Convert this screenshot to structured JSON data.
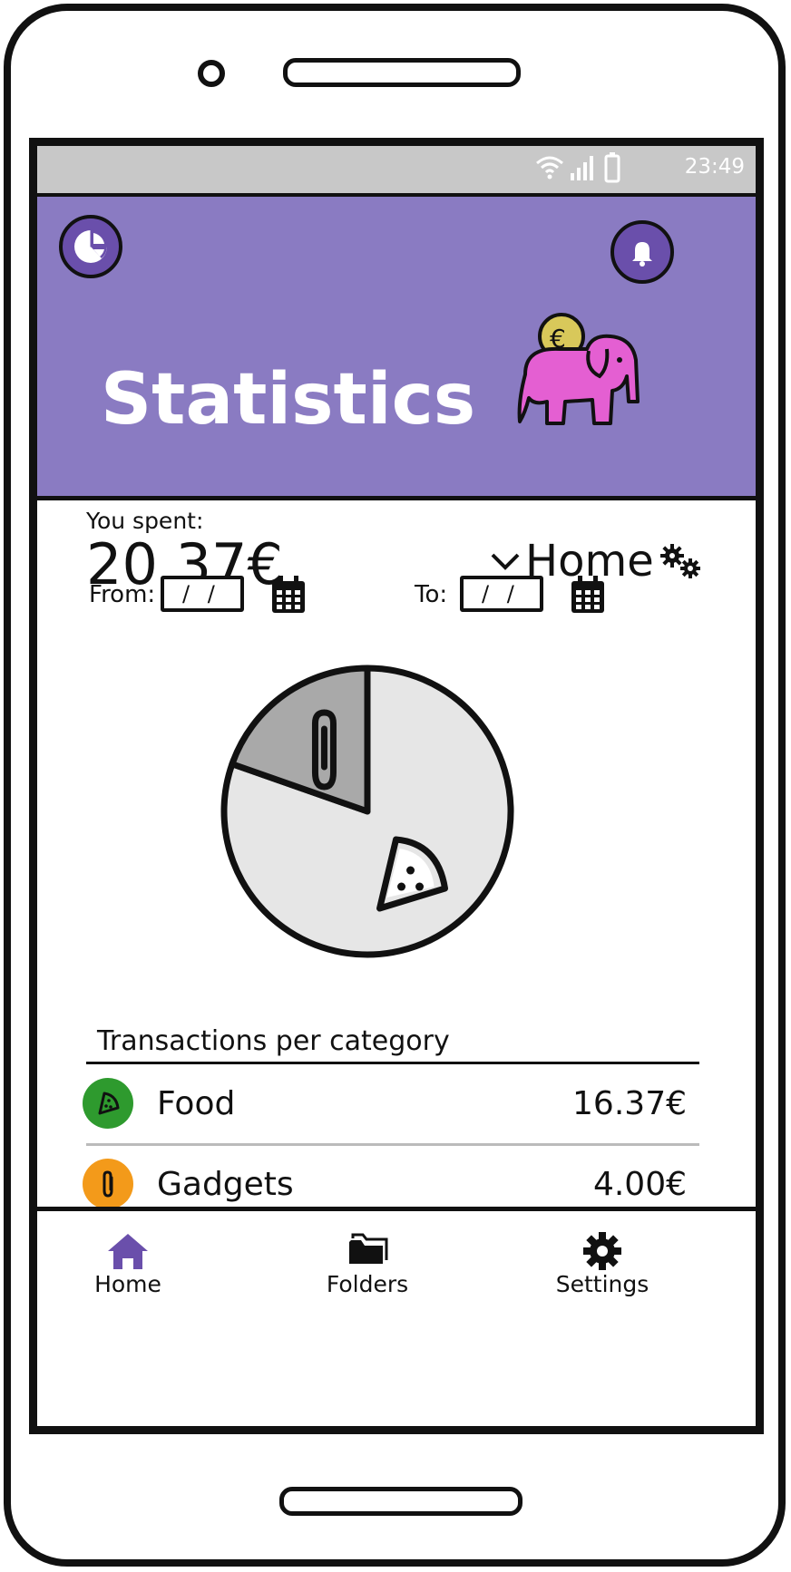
{
  "status_bar": {
    "time": "23:49"
  },
  "header": {
    "title": "Statistics"
  },
  "summary": {
    "spent_label": "You spent:",
    "spent_value": "20.37€"
  },
  "group_select": {
    "value": "Home"
  },
  "date_range": {
    "from_label": "From:",
    "from_value": "/ /",
    "to_label": "To:",
    "to_value": "/ /"
  },
  "chart_data": {
    "type": "pie",
    "slices": [
      {
        "category": "Food",
        "icon": "pizza-icon",
        "value": 16.37,
        "color": "#e6e6e6"
      },
      {
        "category": "Gadgets",
        "icon": "paperclip-icon",
        "value": 4.0,
        "color": "#a9a9a9"
      }
    ]
  },
  "transactions": {
    "title": "Transactions per category",
    "items": [
      {
        "name": "Food",
        "amount": "16.37€",
        "icon": "pizza-icon",
        "color": "#2e9a2e"
      },
      {
        "name": "Gadgets",
        "amount": "4.00€",
        "icon": "paperclip-icon",
        "color": "#f39a1a"
      }
    ]
  },
  "nav": {
    "items": [
      {
        "label": "Home",
        "icon": "home-icon",
        "color": "#6a4fab"
      },
      {
        "label": "Folders",
        "icon": "folder-icon",
        "color": "#111111"
      },
      {
        "label": "Settings",
        "icon": "gear-icon",
        "color": "#111111"
      }
    ]
  },
  "colors": {
    "header": "#8a7bc2",
    "accent": "#6a4fab",
    "mascot": "#e45fd2",
    "coin": "#d8c85a"
  }
}
